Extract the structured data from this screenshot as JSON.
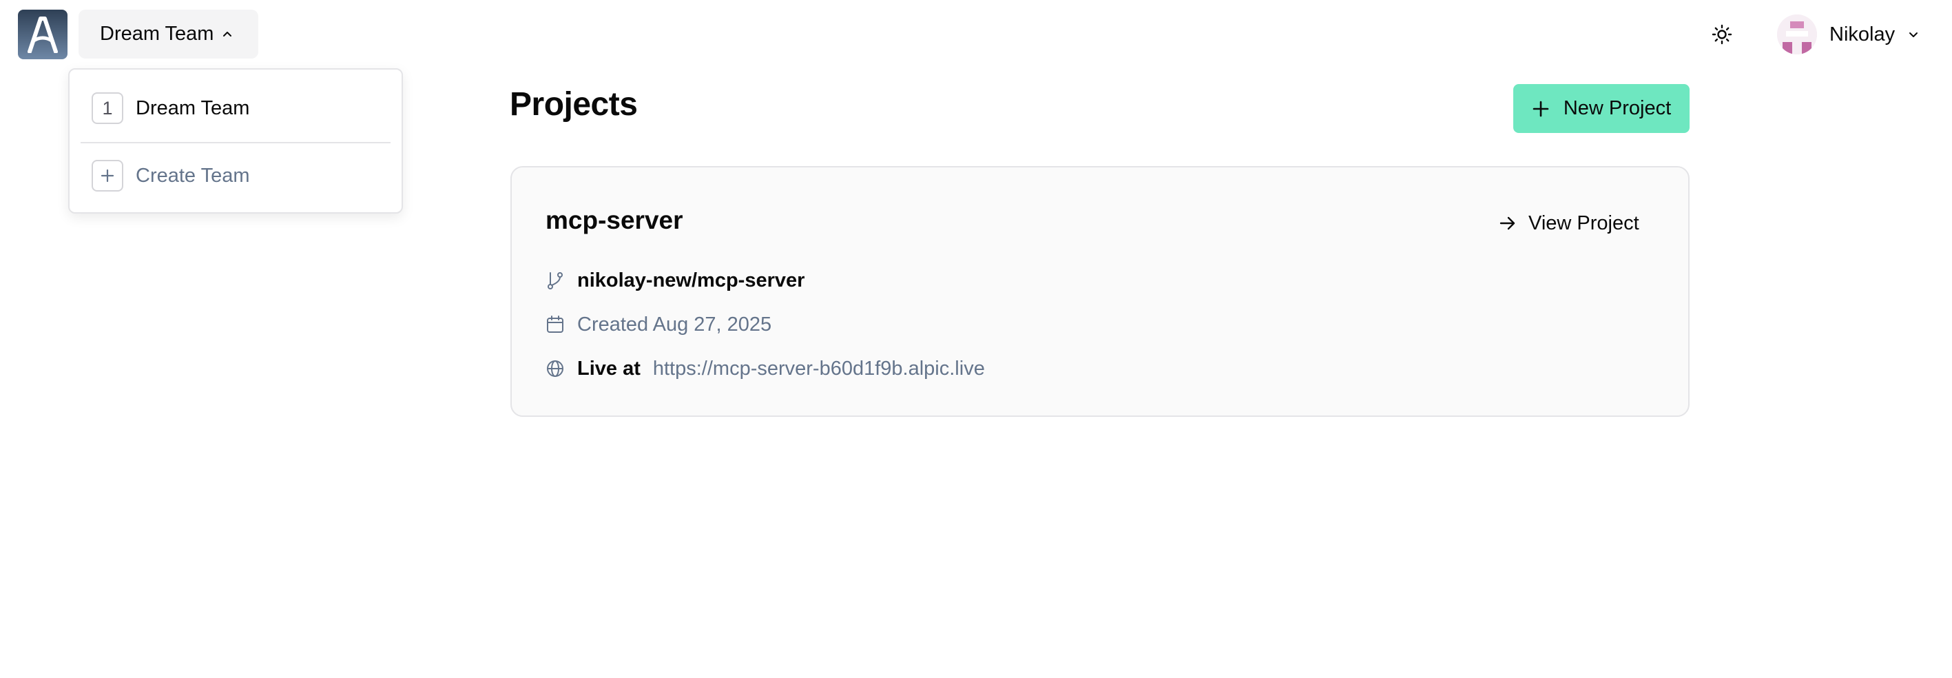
{
  "header": {
    "logo_icon": "alpic-logo-icon",
    "team_switcher": {
      "label": "Dream Team",
      "icon": "chevron-up-icon"
    },
    "theme_toggle_icon": "sun-icon",
    "user": {
      "name": "Nikolay",
      "chevron_icon": "chevron-down-icon"
    }
  },
  "team_menu": {
    "teams": [
      {
        "badge": "1",
        "name": "Dream Team"
      }
    ],
    "create": {
      "label": "Create Team",
      "icon": "plus-icon"
    }
  },
  "main": {
    "title": "Projects",
    "new_project": {
      "label": "New Project",
      "icon": "plus-icon"
    },
    "projects": [
      {
        "name": "mcp-server",
        "view_label": "View Project",
        "repo": "nikolay-new/mcp-server",
        "created": "Created Aug 27, 2025",
        "live_label": "Live at",
        "live_url": "https://mcp-server-b60d1f9b.alpic.live"
      }
    ]
  },
  "colors": {
    "accent": "#6ee7c0",
    "muted_text": "#64748b",
    "card_bg": "#fafafa",
    "border": "#e4e4e7"
  }
}
